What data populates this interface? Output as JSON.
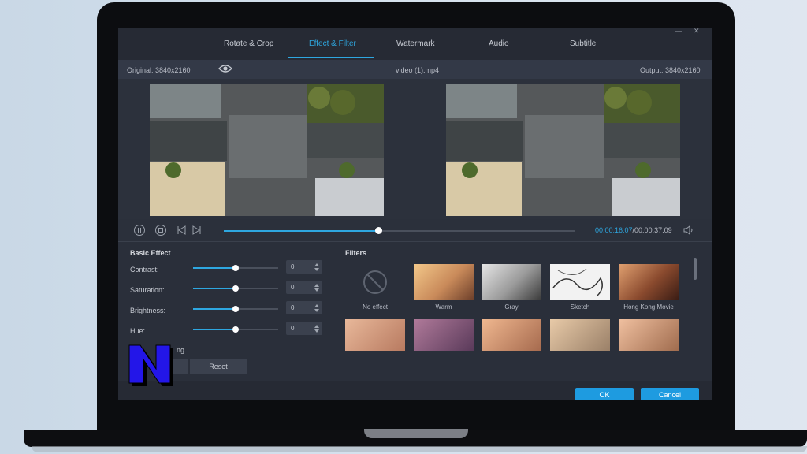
{
  "tabs": [
    {
      "label": "Rotate & Crop",
      "active": false
    },
    {
      "label": "Effect & Filter",
      "active": true
    },
    {
      "label": "Watermark",
      "active": false
    },
    {
      "label": "Audio",
      "active": false
    },
    {
      "label": "Subtitle",
      "active": false
    }
  ],
  "preview": {
    "original_label": "Original: 3840x2160",
    "file_name": "video (1).mp4",
    "output_label": "Output: 3840x2160",
    "eye_icon": "eye-icon"
  },
  "playback": {
    "current_time": "00:00:16.07",
    "total_time": "/00:00:37.09",
    "progress": 0.44,
    "accent": "#2ea7e0"
  },
  "basic_effect": {
    "title": "Basic Effect",
    "rows": [
      {
        "label": "Contrast:",
        "value": "0",
        "level": 0.5
      },
      {
        "label": "Saturation:",
        "value": "0",
        "level": 0.5
      },
      {
        "label": "Brightness:",
        "value": "0",
        "level": 0.5
      },
      {
        "label": "Hue:",
        "value": "0",
        "level": 0.5
      }
    ],
    "partial_label": "ng",
    "reset_label": "Reset"
  },
  "filters": {
    "title": "Filters",
    "items": [
      {
        "label": "No effect"
      },
      {
        "label": "Warm"
      },
      {
        "label": "Gray"
      },
      {
        "label": "Sketch"
      },
      {
        "label": "Hong Kong Movie"
      },
      {
        "label": ""
      },
      {
        "label": ""
      },
      {
        "label": ""
      },
      {
        "label": ""
      },
      {
        "label": ""
      }
    ]
  },
  "footer": {
    "ok_label": "OK",
    "cancel_label": "Cancel"
  }
}
